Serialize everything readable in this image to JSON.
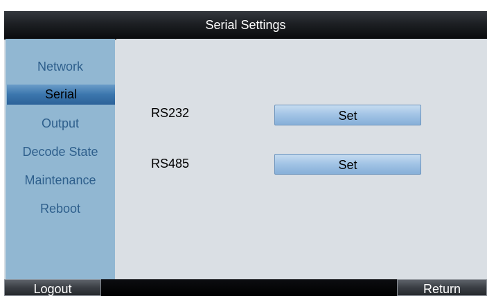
{
  "window": {
    "title": "Serial Settings"
  },
  "sidebar": {
    "items": [
      {
        "label": "Network"
      },
      {
        "label": "Serial"
      },
      {
        "label": "Output"
      },
      {
        "label": "Decode State"
      },
      {
        "label": "Maintenance"
      },
      {
        "label": "Reboot"
      }
    ]
  },
  "main": {
    "rows": [
      {
        "label": "RS232",
        "button_label": "Set"
      },
      {
        "label": "RS485",
        "button_label": "Set"
      }
    ]
  },
  "footer": {
    "logout_label": "Logout",
    "return_label": "Return"
  },
  "colors": {
    "titlebar": "#1d2024",
    "sidebar_bg": "#91b7d2",
    "menu_text": "#2e5f8c",
    "selected_bg": "#3b76ad",
    "content_bg": "#dadfe4",
    "button_bg": "#a4c5e6"
  }
}
